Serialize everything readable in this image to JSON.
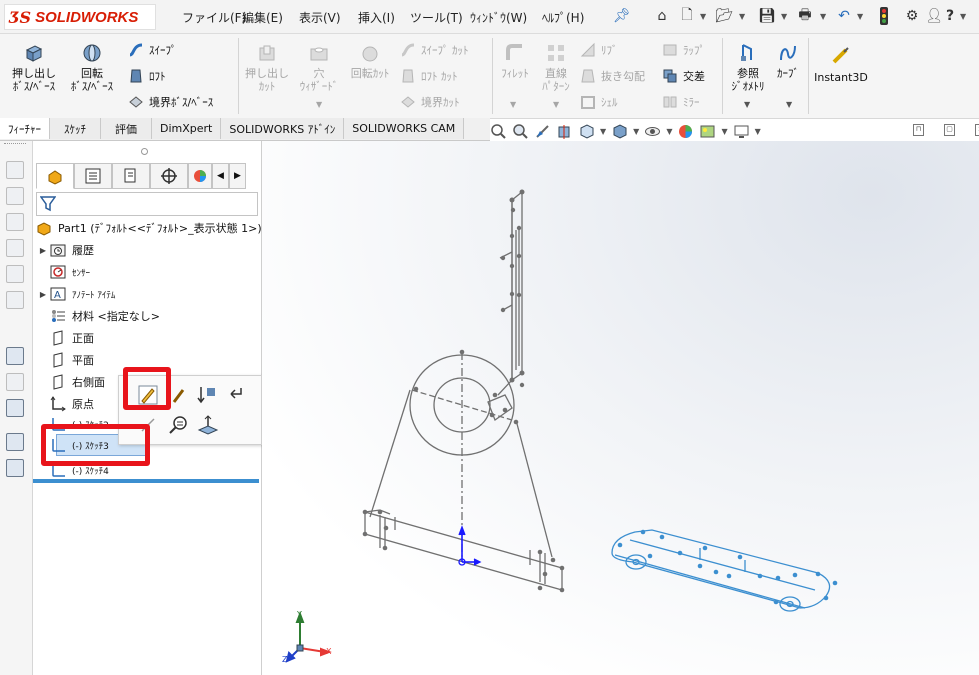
{
  "app": {
    "name": "SOLIDWORKS",
    "brand_color": "#d81e05"
  },
  "menubar": {
    "items": [
      "ファイル(F)",
      "編集(E)",
      "表示(V)",
      "挿入(I)",
      "ツール(T)",
      "ｳｨﾝﾄﾞｳ(W)",
      "ﾍﾙﾌﾟ(H)"
    ],
    "quick_access_icons": [
      "home-icon",
      "new-document-icon",
      "open-icon",
      "save-icon",
      "print-icon",
      "undo-icon",
      "traffic-light-icon",
      "settings-icon",
      "user-icon",
      "help-icon"
    ]
  },
  "command_manager": {
    "features": {
      "extrude_boss": "押し出し\nﾎﾞｽ/ﾍﾞｰｽ",
      "revolve_boss": "回転\nﾎﾞｽ/ﾍﾞｰｽ",
      "sweep": "ｽｲｰﾌﾟ",
      "loft": "ﾛﾌﾄ",
      "boundary_boss": "境界ﾎﾞｽ/ﾍﾞｰｽ",
      "extrude_cut": "押し出し\nｶｯﾄ",
      "hole_wizard": "穴\nｳｨｻﾞｰﾄﾞ",
      "revolve_cut": "回転ｶｯﾄ",
      "swept_cut": "ｽｲｰﾌﾟ ｶｯﾄ",
      "lofted_cut": "ﾛﾌﾄ ｶｯﾄ",
      "boundary_cut": "境界ｶｯﾄ",
      "fillet": "ﾌｨﾚｯﾄ",
      "linear_pattern": "直線\nﾊﾟﾀｰﾝ",
      "rib": "ﾘﾌﾞ",
      "draft": "抜き勾配",
      "shell": "ｼｪﾙ",
      "wrap": "ﾗｯﾌﾟ",
      "intersect": "交差",
      "mirror": "ﾐﾗｰ",
      "reference_geometry": "参照\nｼﾞｵﾒﾄﾘ",
      "curves": "ｶｰﾌﾞ",
      "instant3d": "Instant3D"
    }
  },
  "tabs": [
    "ﾌｨｰﾁｬｰ",
    "ｽｹｯﾁ",
    "評価",
    "DimXpert",
    "SOLIDWORKS ｱﾄﾞｲﾝ",
    "SOLIDWORKS CAM"
  ],
  "feature_tree": {
    "part": "Part1 (ﾃﾞﾌｫﾙﾄ<<ﾃﾞﾌｫﾙﾄ>_表示状態 1>)",
    "items": [
      {
        "label": "履歴",
        "expandable": true
      },
      {
        "label": "ｾﾝｻｰ",
        "expandable": false
      },
      {
        "label": "ｱﾉﾃｰﾄ ｱｲﾃﾑ",
        "expandable": true
      },
      {
        "label": "材料 <指定なし>",
        "expandable": false
      },
      {
        "label": "正面",
        "expandable": false
      },
      {
        "label": "平面",
        "expandable": false
      },
      {
        "label": "右側面",
        "expandable": false
      },
      {
        "label": "原点",
        "expandable": false
      },
      {
        "label": "(-) ｽｹｯﾁ2",
        "expandable": false
      },
      {
        "label": "(-) ｽｹｯﾁ3",
        "expandable": false
      },
      {
        "label": "(-) ｽｹｯﾁ4",
        "expandable": false
      }
    ]
  },
  "triad": {
    "x": "X",
    "y": "Y",
    "z": "Z"
  },
  "colors": {
    "selection_blue": "#3c8fd0",
    "highlight_red": "#e8141b",
    "sketch_gray": "#707070"
  }
}
